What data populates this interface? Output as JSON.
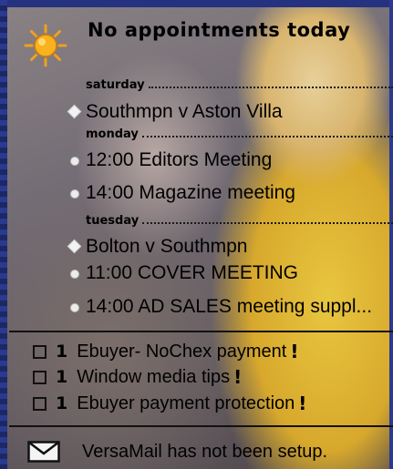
{
  "today": {
    "icon": "sun-icon",
    "headline": "No appointments today"
  },
  "agenda": [
    {
      "day": "saturday",
      "items": [
        {
          "bullet": "diamond",
          "text": "Southmpn v Aston Villa"
        }
      ]
    },
    {
      "day": "monday",
      "items": [
        {
          "bullet": "dot",
          "text": "12:00 Editors Meeting"
        },
        {
          "bullet": "dot",
          "text": "14:00 Magazine meeting"
        }
      ]
    },
    {
      "day": "tuesday",
      "items": [
        {
          "bullet": "diamond",
          "text": "Bolton v Southmpn"
        },
        {
          "bullet": "dot",
          "text": "11:00 COVER MEETING"
        },
        {
          "bullet": "dot",
          "text": "14:00 AD SALES meeting suppl..."
        }
      ]
    }
  ],
  "tasks": [
    {
      "priority": "1",
      "text": "Ebuyer- NoChex payment",
      "flag": "!"
    },
    {
      "priority": "1",
      "text": "Window media tips",
      "flag": "!"
    },
    {
      "priority": "1",
      "text": "Ebuyer payment protection",
      "flag": "!"
    }
  ],
  "mail": {
    "icon": "envelope-icon",
    "text": "VersaMail has not been setup."
  },
  "colors": {
    "frame": "#25327f",
    "sun": "#f3a51c"
  }
}
